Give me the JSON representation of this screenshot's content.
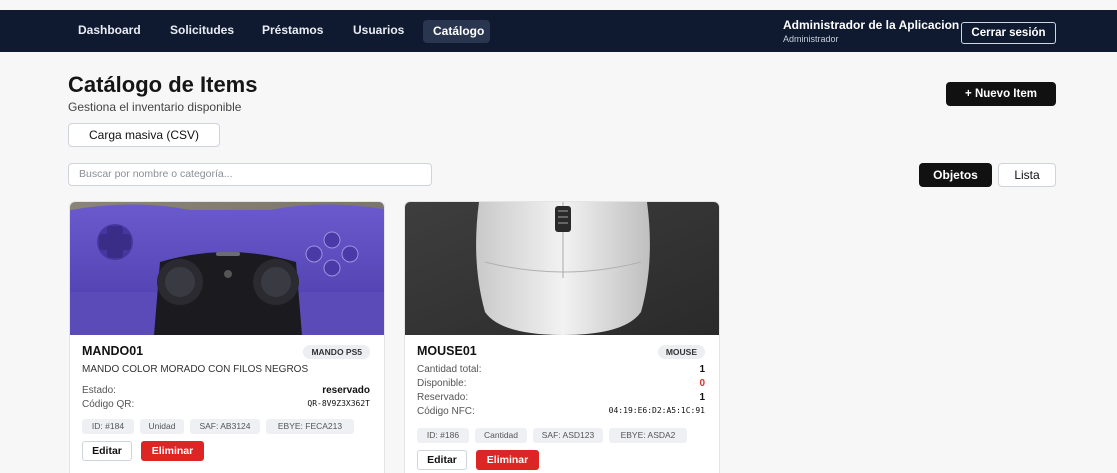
{
  "nav": {
    "items": [
      "Dashboard",
      "Solicitudes",
      "Préstamos",
      "Usuarios",
      "Catálogo"
    ],
    "active": "Catálogo",
    "user_name": "Administrador de la Aplicacion",
    "user_role": "Administrador",
    "logout_label": "Cerrar sesión"
  },
  "header": {
    "title": "Catálogo de Items",
    "subtitle": "Gestiona el inventario disponible",
    "new_item_label": "+ Nuevo Item",
    "bulk_upload_label": "Carga masiva (CSV)"
  },
  "search": {
    "placeholder": "Buscar por nombre o categoría..."
  },
  "view_toggle": {
    "objects_label": "Objetos",
    "list_label": "Lista",
    "selected": "Objetos"
  },
  "items": [
    {
      "name": "MANDO01",
      "category": "MANDO PS5",
      "description": "MANDO COLOR MORADO CON FILOS NEGROS",
      "fields": [
        {
          "label": "Estado:",
          "value": "reservado"
        },
        {
          "label": "Código QR:",
          "value": "QR-8V9Z3X362T"
        }
      ],
      "tags": [
        "ID: #184",
        "Unidad",
        "SAF: AB3124",
        "EBYE: FECA213"
      ],
      "edit_label": "Editar",
      "delete_label": "Eliminar"
    },
    {
      "name": "MOUSE01",
      "category": "MOUSE",
      "fields": [
        {
          "label": "Cantidad total:",
          "value": "1"
        },
        {
          "label": "Disponible:",
          "value": "0"
        },
        {
          "label": "Reservado:",
          "value": "1"
        },
        {
          "label": "Código NFC:",
          "value": "04:19:E6:D2:A5:1C:91"
        }
      ],
      "tags": [
        "ID: #186",
        "Cantidad",
        "SAF: ASD123",
        "EBYE: ASDA2"
      ],
      "edit_label": "Editar",
      "delete_label": "Eliminar"
    }
  ],
  "colors": {
    "navbar": "#0f1a30",
    "primary": "#111111",
    "danger": "#dc2626",
    "unavailable": "#d9312b"
  }
}
